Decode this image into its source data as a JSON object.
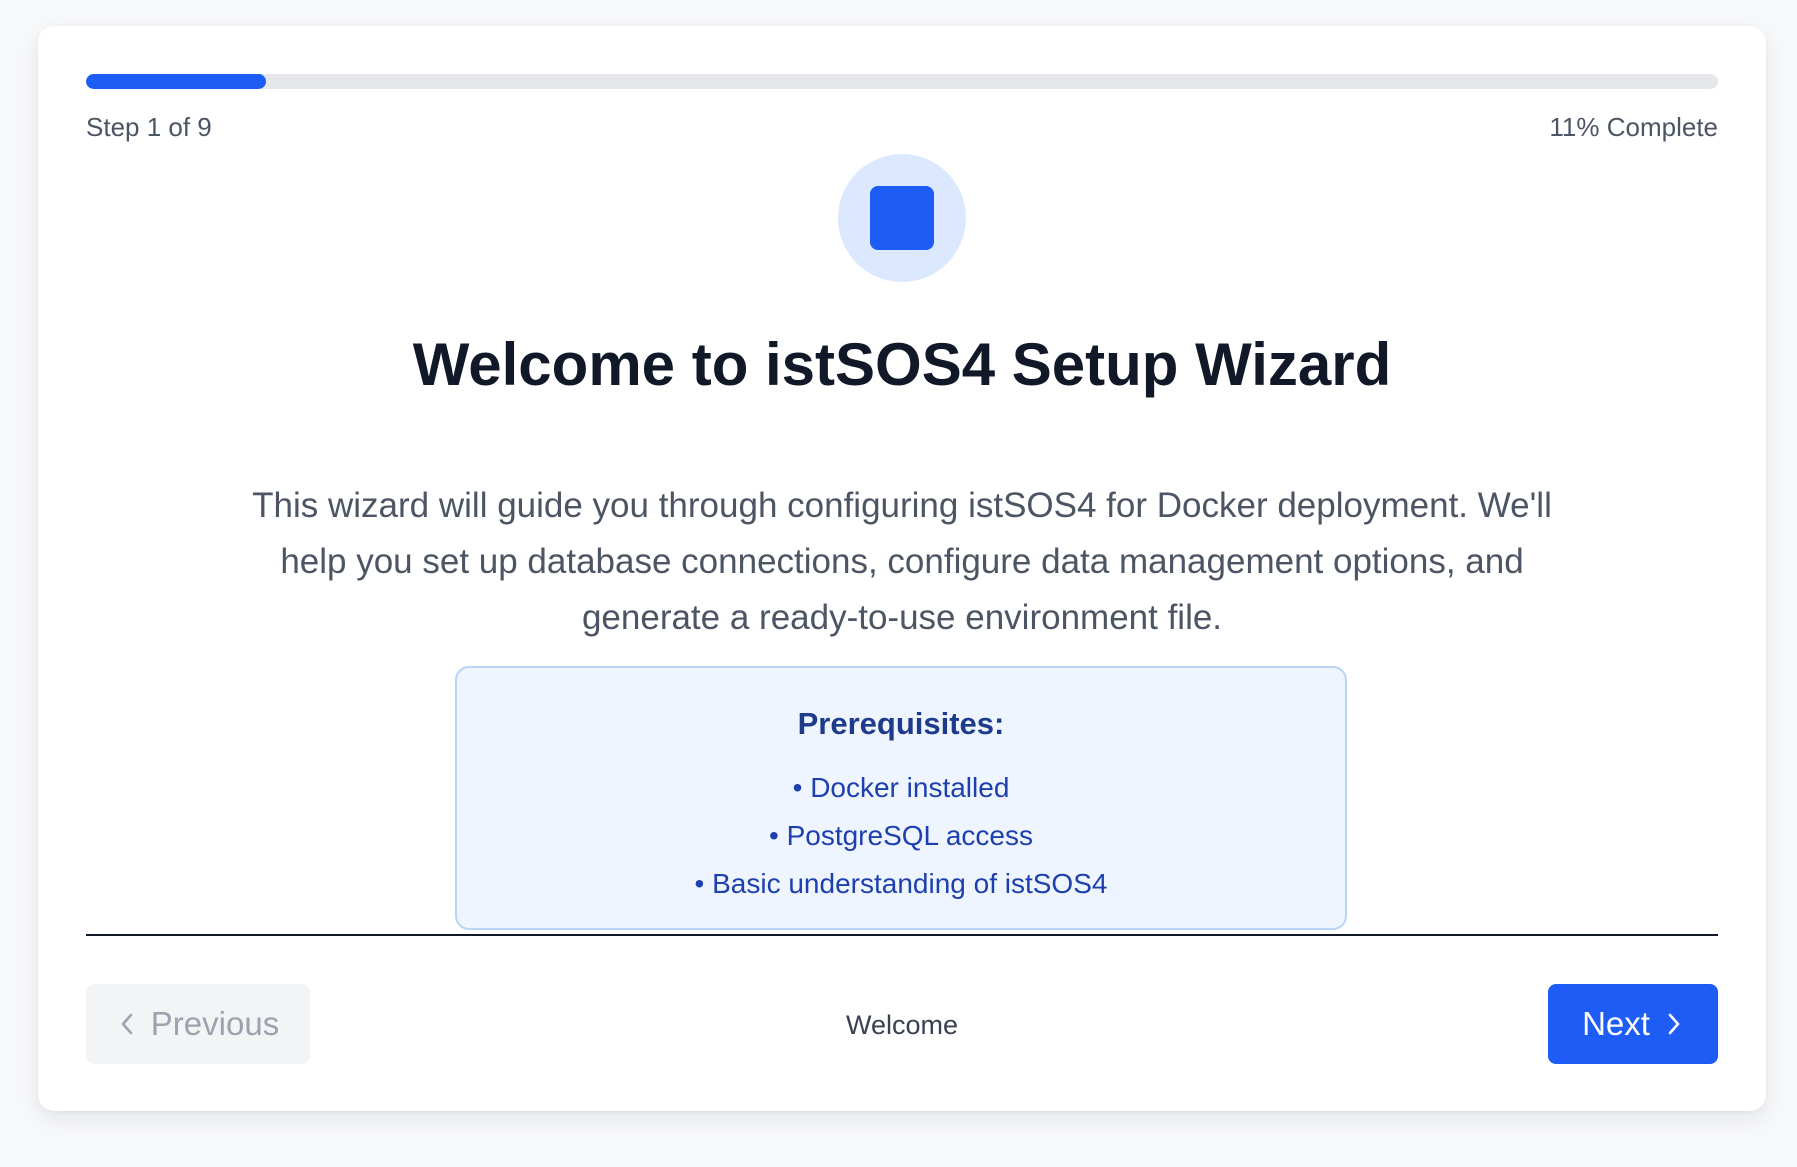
{
  "progress": {
    "step_label": "Step 1 of 9",
    "percent_label": "11% Complete",
    "fraction": 0.11
  },
  "header": {
    "icon": "blue-square-icon",
    "title": "Welcome to istSOS4 Setup Wizard"
  },
  "main": {
    "description": "This wizard will guide you through configuring istSOS4 for Docker deployment. We'll help you set up database connections, configure data management options, and generate a ready-to-use environment file.",
    "prerequisites": {
      "title": "Prerequisites:",
      "items": [
        "• Docker installed",
        "• PostgreSQL access",
        "• Basic understanding of istSOS4"
      ]
    }
  },
  "footer": {
    "previous_label": "Previous",
    "current_step_name": "Welcome",
    "next_label": "Next"
  },
  "colors": {
    "accent": "#1d5cf5",
    "icon_bg": "#dbe8fe",
    "info_bg": "#eef5fe",
    "info_border": "#bad4f6",
    "info_text": "#1e40af"
  }
}
